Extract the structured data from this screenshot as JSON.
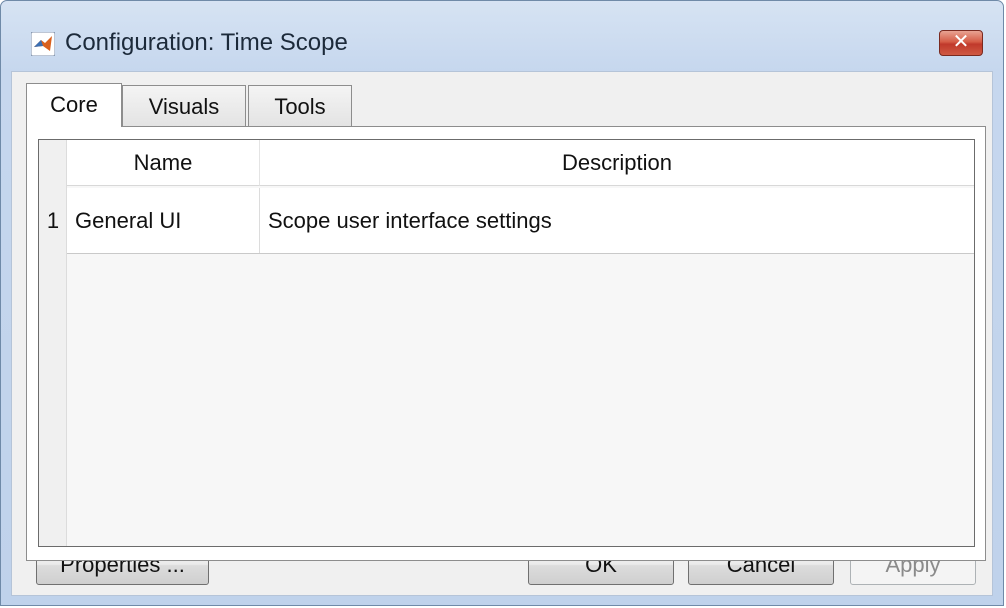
{
  "window": {
    "title": "Configuration: Time Scope",
    "close_glyph": "✕",
    "icon": "matlab-icon"
  },
  "tabs": [
    {
      "label": "Core",
      "active": true
    },
    {
      "label": "Visuals",
      "active": false
    },
    {
      "label": "Tools",
      "active": false
    }
  ],
  "table": {
    "columns": [
      "Name",
      "Description"
    ],
    "rows": [
      {
        "index": "1",
        "name": "General UI",
        "description": "Scope user interface settings"
      }
    ]
  },
  "buttons": {
    "properties": "Properties ...",
    "ok": "OK",
    "cancel": "Cancel",
    "apply": "Apply",
    "apply_enabled": false
  },
  "colors": {
    "close_button": "#c0392b",
    "frame": "#bfd2eb"
  }
}
